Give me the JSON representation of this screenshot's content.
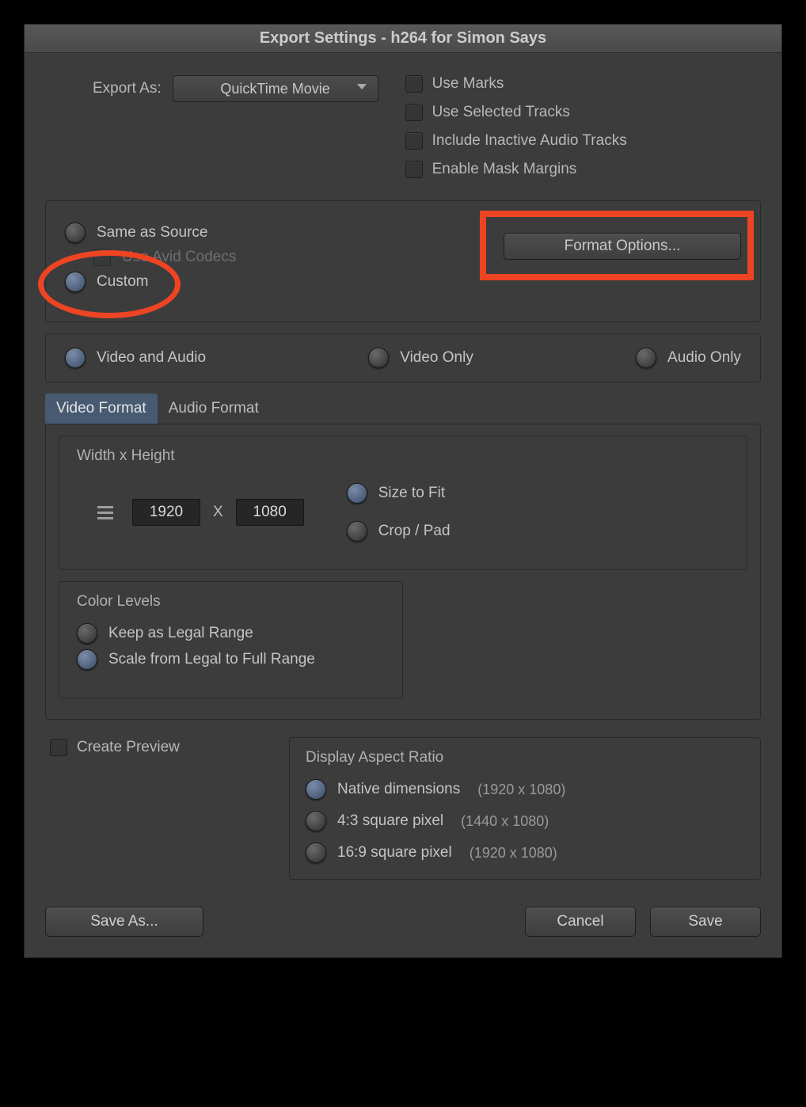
{
  "title": "Export Settings - h264 for Simon Says",
  "export_as": {
    "label": "Export As:",
    "value": "QuickTime Movie"
  },
  "checks": {
    "use_marks": "Use Marks",
    "use_selected_tracks": "Use Selected Tracks",
    "include_inactive_audio": "Include Inactive Audio Tracks",
    "enable_mask_margins": "Enable Mask Margins"
  },
  "source_group": {
    "same_as_source": "Same as Source",
    "use_avid_codecs": "Use Avid Codecs",
    "custom": "Custom",
    "format_options": "Format Options..."
  },
  "content": {
    "video_audio": "Video and Audio",
    "video_only": "Video Only",
    "audio_only": "Audio Only"
  },
  "tabs": {
    "video_format": "Video Format",
    "audio_format": "Audio Format"
  },
  "wh": {
    "title": "Width x Height",
    "width": "1920",
    "x": "X",
    "height": "1080",
    "size_to_fit": "Size to Fit",
    "crop_pad": "Crop / Pad"
  },
  "color_levels": {
    "title": "Color Levels",
    "keep": "Keep as Legal Range",
    "scale": "Scale from Legal to Full Range"
  },
  "create_preview": "Create Preview",
  "aspect": {
    "title": "Display Aspect Ratio",
    "native": "Native dimensions",
    "native_dim": "(1920 x 1080)",
    "p43": "4:3 square pixel",
    "p43_dim": "(1440 x 1080)",
    "p169": "16:9 square pixel",
    "p169_dim": "(1920 x 1080)"
  },
  "footer": {
    "save_as": "Save As...",
    "cancel": "Cancel",
    "save": "Save"
  }
}
